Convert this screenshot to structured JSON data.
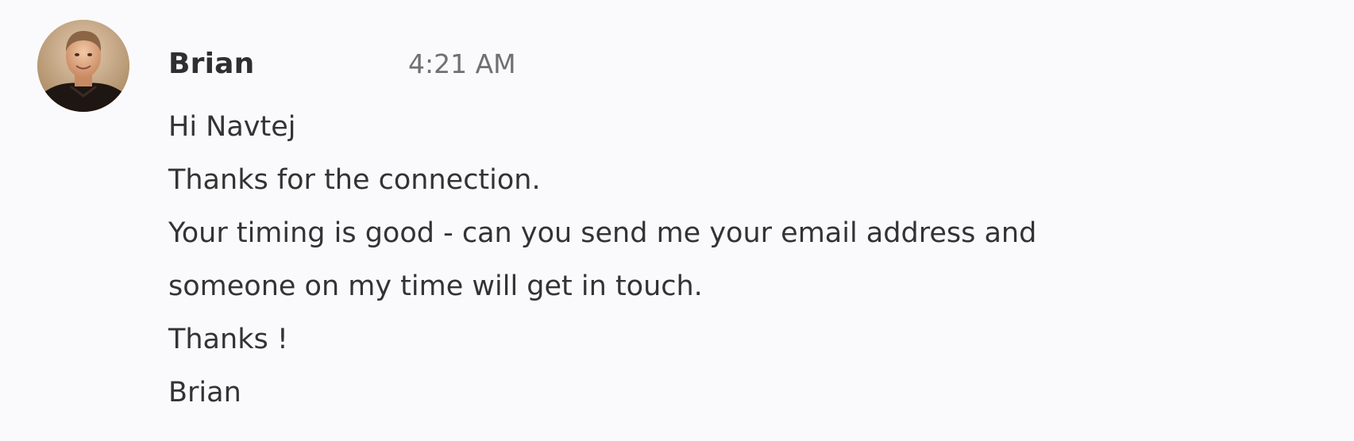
{
  "message": {
    "avatar_icon": "user-avatar-photo",
    "sender": "Brian",
    "timestamp": "4:21 AM",
    "lines": [
      "Hi Navtej",
      "Thanks for the connection.",
      "Your timing is good - can you send me your email address and",
      "someone on my time will get in touch.",
      "Thanks !",
      "Brian"
    ]
  },
  "colors": {
    "background": "#fafafd",
    "sender_text": "#2f2f2f",
    "timestamp_text": "#707070",
    "body_text": "#333333"
  }
}
